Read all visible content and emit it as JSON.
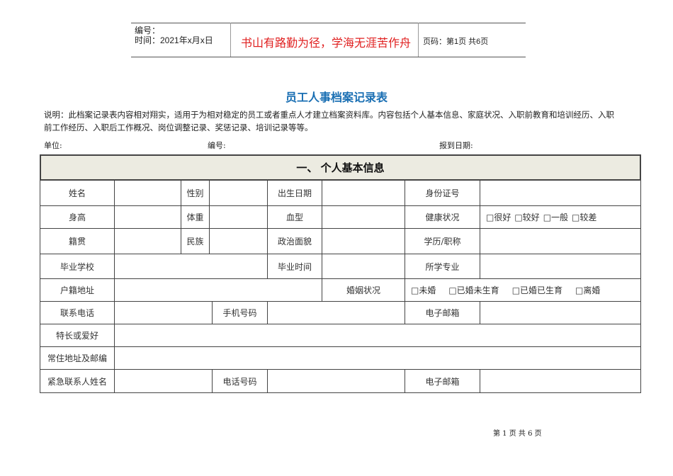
{
  "header": {
    "number_label": "编号：",
    "time_label": "时间：2021年x月x日",
    "motto": "书山有路勤为径，学海无涯苦作舟",
    "page_info": "页码：第1页  共6页"
  },
  "title": "员工人事档案记录表",
  "description_line1": "说明：此档案记录表内容相对翔实，适用于为相对稳定的员工或者重点人才建立档案资料库。内容包括个人基本信息、家庭状况、入职前教育和培训经历、入职",
  "description_line2": "前工作经历、入职后工作概况、岗位调整记录、奖惩记录、培训记录等等。",
  "meta": {
    "unit": "单位:",
    "number": "编号:",
    "report_date": "报到日期:"
  },
  "section_title": "一、   个人基本信息",
  "labels": {
    "name": "姓名",
    "gender": "性别",
    "birth": "出生日期",
    "id": "身份证号",
    "height": "身高",
    "weight": "体重",
    "blood": "血型",
    "health": "健康状况",
    "native": "籍贯",
    "ethnic": "民族",
    "political": "政治面貌",
    "education": "学历/职称",
    "school": "毕业学校",
    "grad_time": "毕业时间",
    "major": "所学专业",
    "hukou": "户籍地址",
    "marriage": "婚姻状况",
    "phone": "联系电话",
    "mobile": "手机号码",
    "email": "电子邮箱",
    "hobby": "特长或爱好",
    "address": "常住地址及邮编",
    "emergency": "紧急联系人姓名",
    "tel": "电话号码",
    "email2": "电子邮箱"
  },
  "health_options": [
    "□很好",
    "□较好",
    "□一般",
    "□较差"
  ],
  "marriage_options": [
    "□未婚",
    "□已婚未生育",
    "□已婚已生育",
    "□离婚"
  ],
  "footer": "第 1 页 共 6 页"
}
